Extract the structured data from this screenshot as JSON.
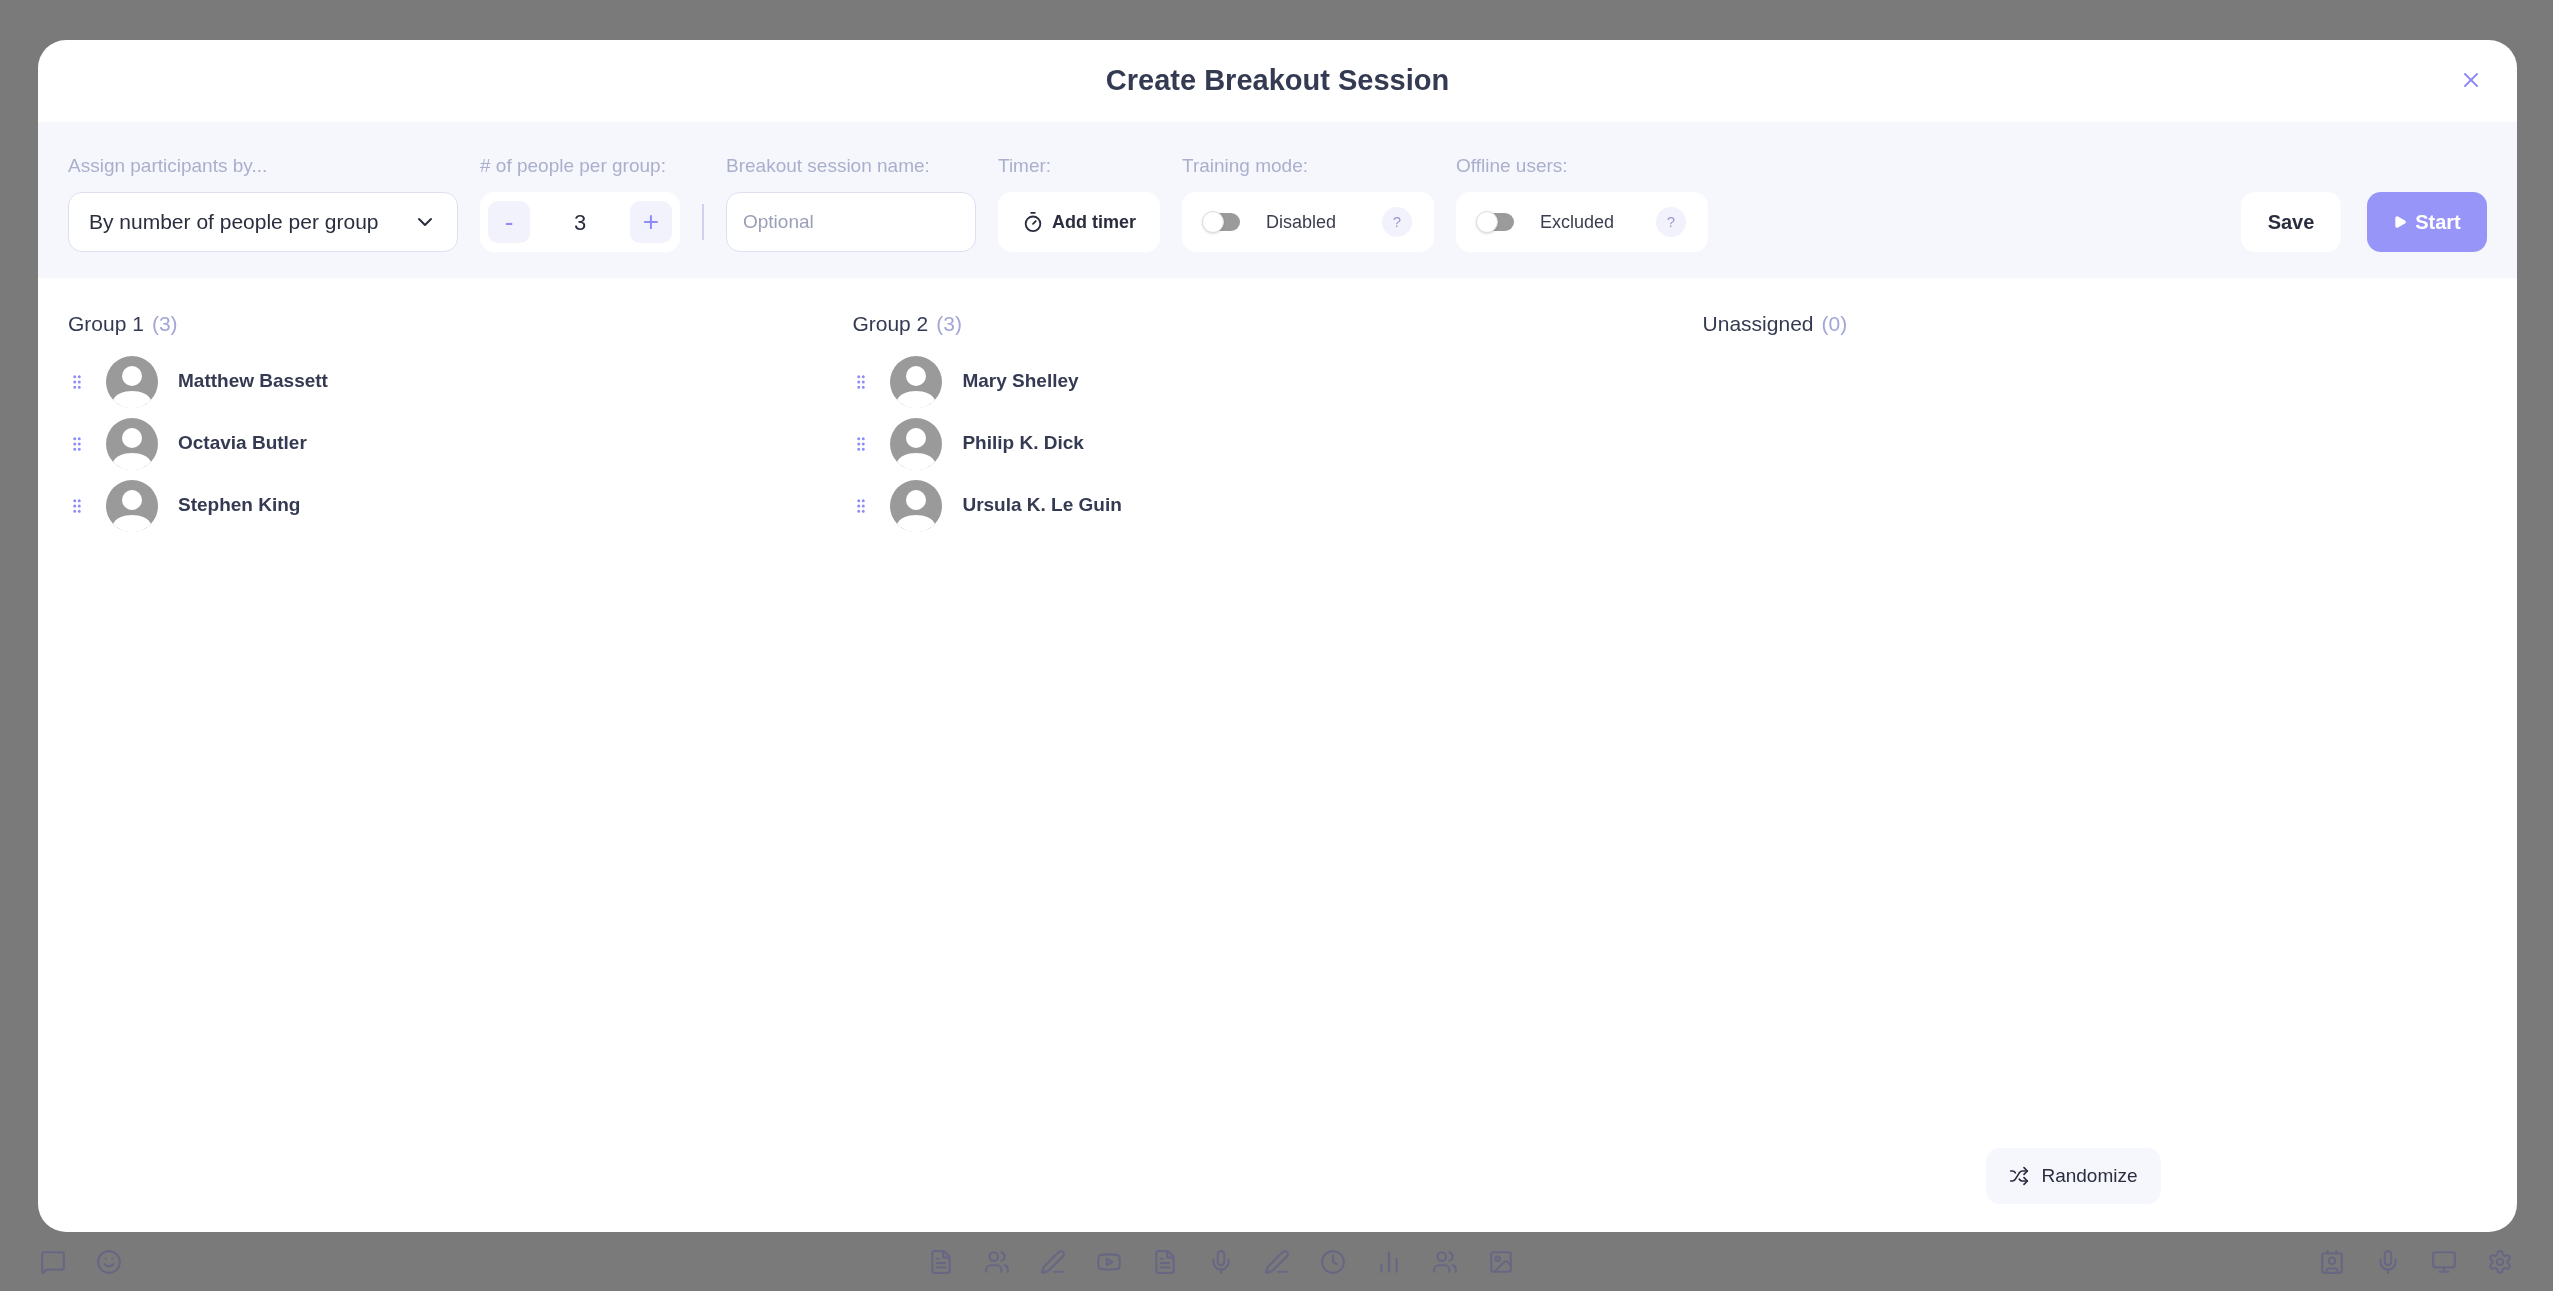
{
  "dialog": {
    "title": "Create Breakout Session"
  },
  "settings": {
    "assign": {
      "label": "Assign participants by...",
      "value": "By number of people per group"
    },
    "per_group": {
      "label": "# of people per group:",
      "value": "3",
      "decrement": "-",
      "increment": "+"
    },
    "name": {
      "label": "Breakout session name:",
      "placeholder": "Optional"
    },
    "timer": {
      "label": "Timer:",
      "button": "Add timer"
    },
    "toggles": [
      {
        "label": "Training mode:",
        "state_text": "Disabled",
        "on": false,
        "help": "?"
      },
      {
        "label": "Offline users:",
        "state_text": "Excluded",
        "on": false,
        "help": "?"
      }
    ],
    "save": "Save",
    "start": "Start"
  },
  "groups": [
    {
      "title": "Group 1",
      "count": "(3)",
      "members": [
        "Matthew Bassett",
        "Octavia Butler",
        "Stephen King"
      ]
    },
    {
      "title": "Group 2",
      "count": "(3)",
      "members": [
        "Mary Shelley",
        "Philip K. Dick",
        "Ursula K. Le Guin"
      ]
    },
    {
      "title": "Unassigned",
      "count": "(0)"
    }
  ],
  "randomize": "Randomize"
}
